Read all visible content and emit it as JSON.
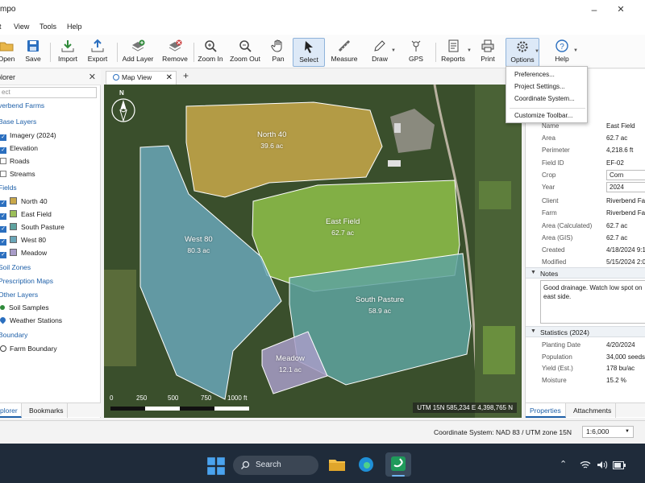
{
  "app": {
    "title": "mpo"
  },
  "menu": [
    "t",
    "View",
    "Tools",
    "Help"
  ],
  "toolbar": {
    "open": "Open",
    "save": "Save",
    "import": "Import",
    "export": "Export",
    "add_layer": "Add Layer",
    "remove": "Remove",
    "zoom_in": "Zoom In",
    "zoom_out": "Zoom Out",
    "pan": "Pan",
    "select": "Select",
    "measure": "Measure",
    "draw": "Draw",
    "gps": "GPS",
    "reports": "Reports",
    "print": "Print",
    "options": "Options",
    "help": "Help"
  },
  "left_panel": {
    "title": "plorer",
    "search_placeholder": "ect",
    "root": "verbend Farms",
    "groups": {
      "base_layers": "Base Layers",
      "fields": "Fields",
      "soil_zones": "Soil Zones",
      "prescription_maps": "Prescription Maps",
      "other_layers": "Other Layers",
      "boundary": "Boundary"
    },
    "base_layers": [
      "Imagery (2024)",
      "Elevation",
      "Roads",
      "Streams"
    ],
    "fields": [
      "North 40",
      "East Field",
      "South Pasture",
      "West 80",
      "Meadow"
    ],
    "field_colors": [
      "#c9a84a",
      "#9cbf5a",
      "#5fa3a0",
      "#6aa6b8",
      "#a89cc8"
    ],
    "other_layers": [
      "Soil Samples",
      "Weather Stations"
    ],
    "boundary_items": [
      "Farm Boundary"
    ],
    "tabs": [
      "plorer",
      "Bookmarks"
    ]
  },
  "map": {
    "tab_label": "Map View",
    "add_tab": "+",
    "north_label": "N",
    "scale_ticks": [
      "0",
      "250",
      "500",
      "750",
      "1000 ft"
    ],
    "coordinates": "UTM 15N   585,234 E   4,398,765 N",
    "fields": [
      {
        "name": "North 40",
        "area": "39.6 ac",
        "color": "#c9a84a"
      },
      {
        "name": "East Field",
        "area": "62.7 ac",
        "color": "#8fbf4a"
      },
      {
        "name": "West 80",
        "area": "80.3 ac",
        "color": "#6aa6b8"
      },
      {
        "name": "South Pasture",
        "area": "58.9 ac",
        "color": "#5fa3a0"
      },
      {
        "name": "Meadow",
        "area": "12.1 ac",
        "color": "#a89cc8"
      }
    ]
  },
  "options_menu": [
    "Preferences...",
    "Project Settings...",
    "Coordinate System...",
    "Customize Toolbar..."
  ],
  "properties": {
    "rows": [
      {
        "k": "Name",
        "v": "East Field"
      },
      {
        "k": "Area",
        "v": "62.7 ac"
      },
      {
        "k": "Perimeter",
        "v": "4,218.6 ft"
      },
      {
        "k": "Field ID",
        "v": "EF-02"
      },
      {
        "k": "Crop",
        "v": "Corn"
      },
      {
        "k": "Year",
        "v": "2024"
      },
      {
        "k": "Client",
        "v": "Riverbend Far"
      },
      {
        "k": "Farm",
        "v": "Riverbend Far"
      },
      {
        "k": "Area (Calculated)",
        "v": "62.7 ac"
      },
      {
        "k": "Area (GIS)",
        "v": "62.7 ac"
      },
      {
        "k": "Created",
        "v": "4/18/2024 9:1"
      },
      {
        "k": "Modified",
        "v": "5/15/2024 2:0"
      }
    ],
    "notes_title": "Notes",
    "notes_text": "Good drainage. Watch low spot on east side.",
    "stats_title": "Statistics (2024)",
    "stats": [
      {
        "k": "Planting Date",
        "v": "4/20/2024"
      },
      {
        "k": "Population",
        "v": "34,000 seeds/"
      },
      {
        "k": "Yield (Est.)",
        "v": "178 bu/ac"
      },
      {
        "k": "Moisture",
        "v": "15.2 %"
      }
    ],
    "tabs": [
      "Properties",
      "Attachments"
    ]
  },
  "statusbar": {
    "coord_system": "Coordinate System:  NAD 83 / UTM zone 15N",
    "scale": "1:6,000"
  },
  "taskbar": {
    "search": "Search"
  }
}
